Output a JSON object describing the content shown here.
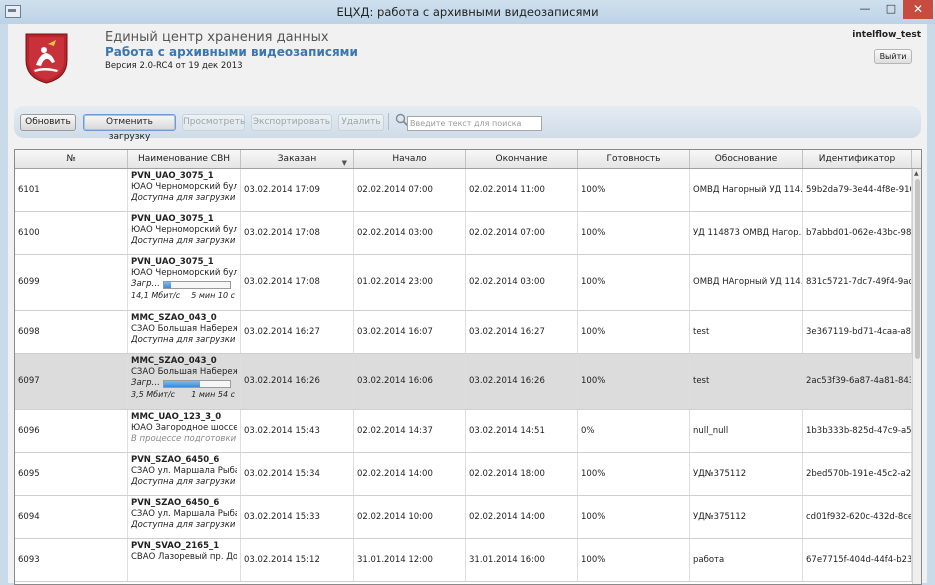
{
  "window": {
    "title": "ЕЦХД: работа с архивными видеозаписями"
  },
  "header": {
    "line1": "Единый центр хранения данных",
    "line2": "Работа с архивными видеозаписями",
    "version": "Версия 2.0-RC4 от 19 дек 2013",
    "user": "intelflow_test",
    "logout": "Выйти"
  },
  "toolbar": {
    "refresh": "Обновить",
    "cancel_download": "Отменить загрузку",
    "view": "Просмотреть",
    "export": "Экспортировать",
    "delete": "Удалить",
    "search_placeholder": "Введите текст для поиска"
  },
  "table": {
    "columns": [
      "№",
      "Наименование СВН",
      "Заказан",
      "Начало",
      "Окончание",
      "Готовность",
      "Обоснование",
      "Идентификатор"
    ],
    "sorted_column": "Заказан",
    "rows": [
      {
        "id": "6101",
        "name": "PVN_UAO_3075_1",
        "addr": "ЮАО Черноморский бул…",
        "status": "Доступна для загрузки",
        "ordered": "03.02.2014 17:09",
        "start": "02.02.2014 07:00",
        "end": "02.02.2014 11:00",
        "ready": "100%",
        "reason": "ОМВД Нагорный УД 114…",
        "uid": "59b2da79-3e44-4f8e-910…"
      },
      {
        "id": "6100",
        "name": "PVN_UAO_3075_1",
        "addr": "ЮАО Черноморский бул…",
        "status": "Доступна для загрузки",
        "ordered": "03.02.2014 17:08",
        "start": "02.02.2014 03:00",
        "end": "02.02.2014 07:00",
        "ready": "100%",
        "reason": "УД 114873 ОМВД Нагор…",
        "uid": "b7abbd01-062e-43bc-982…"
      },
      {
        "id": "6099",
        "name": "PVN_UAO_3075_1",
        "addr": "ЮАО Черноморский бул…",
        "status_label": "Загр…",
        "progress": 0.1,
        "speed": "14,1 Мбит/с",
        "eta": "5 мин 10 с",
        "ordered": "03.02.2014 17:08",
        "start": "01.02.2014 23:00",
        "end": "02.02.2014 03:00",
        "ready": "100%",
        "reason": "ОМВД НАгорный УД 114…",
        "uid": "831c5721-7dc7-49f4-9ac8…"
      },
      {
        "id": "6098",
        "name": "MMC_SZAO_043_0",
        "addr": "СЗАО Большая Набереж…",
        "status": "Доступна для загрузки",
        "ordered": "03.02.2014 16:27",
        "start": "03.02.2014 16:07",
        "end": "03.02.2014 16:27",
        "ready": "100%",
        "reason": "test",
        "uid": "3e367119-bd71-4caa-a80…"
      },
      {
        "id": "6097",
        "name": "MMC_SZAO_043_0",
        "addr": "СЗАО Большая Набереж…",
        "status_label": "Загр…",
        "progress": 0.55,
        "speed": "3,5 Мбит/с",
        "eta": "1 мин 54 с",
        "ordered": "03.02.2014 16:26",
        "start": "03.02.2014 16:06",
        "end": "03.02.2014 16:26",
        "ready": "100%",
        "reason": "test",
        "uid": "2ac53f39-6a87-4a81-843e…",
        "selected": true
      },
      {
        "id": "6096",
        "name": "MMC_UAO_123_3_0",
        "addr": "ЮАО Загородное шоссе …",
        "status": "В процессе подготовки",
        "status_grey": true,
        "ordered": "03.02.2014 15:43",
        "start": "02.02.2014 14:37",
        "end": "03.02.2014 14:51",
        "ready": "0%",
        "reason": "null_null",
        "uid": "1b3b333b-825d-47c9-a59…"
      },
      {
        "id": "6095",
        "name": "PVN_SZAO_6450_6",
        "addr": "СЗАО ул. Маршала Рыба…",
        "status": "Доступна для загрузки",
        "ordered": "03.02.2014 15:34",
        "start": "02.02.2014 14:00",
        "end": "02.02.2014 18:00",
        "ready": "100%",
        "reason": "УД№375112",
        "uid": "2bed570b-191e-45c2-a25…"
      },
      {
        "id": "6094",
        "name": "PVN_SZAO_6450_6",
        "addr": "СЗАО ул. Маршала Рыба…",
        "status": "Доступна для загрузки",
        "ordered": "03.02.2014 15:33",
        "start": "02.02.2014 10:00",
        "end": "02.02.2014 14:00",
        "ready": "100%",
        "reason": "УД№375112",
        "uid": "cd01f932-620c-432d-8cea…"
      },
      {
        "id": "6093",
        "name": "PVN_SVAO_2165_1",
        "addr": "СВАО Лазоревый пр. До…",
        "status": "",
        "ordered": "03.02.2014 15:12",
        "start": "31.01.2014 12:00",
        "end": "31.01.2014 16:00",
        "ready": "100%",
        "reason": "работа",
        "uid": "67e7715f-404d-44f4-b23c…"
      }
    ]
  }
}
